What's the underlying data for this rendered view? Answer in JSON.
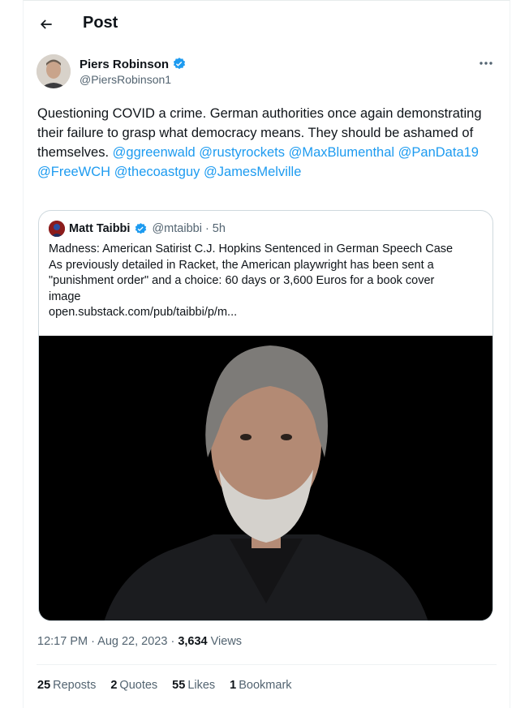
{
  "header": {
    "title": "Post"
  },
  "author": {
    "name": "Piers Robinson",
    "handle": "@PiersRobinson1",
    "verified": true
  },
  "tweet": {
    "text_plain": "Questioning COVID a crime. German authorities once again demonstrating their failure to grasp what democracy means. They should be ashamed of themselves.",
    "mentions": [
      "@ggreenwald",
      "@rustyrockets",
      "@MaxBlumenthal",
      "@PanData19",
      "@FreeWCH",
      "@thecoastguy",
      "@JamesMelville"
    ]
  },
  "quote": {
    "name": "Matt Taibbi",
    "verified": true,
    "handle_time": "@mtaibbi · 5h",
    "lines": [
      "Madness: American Satirist C.J. Hopkins Sentenced in German Speech Case",
      "As previously detailed in Racket, the American playwright has been sent a",
      "\"punishment order\" and a choice: 60 days or 3,600 Euros for a book cover",
      "image",
      "open.substack.com/pub/taibbi/p/m..."
    ]
  },
  "meta": {
    "time_date": "12:17 PM · Aug 22, 2023 · ",
    "views_count": "3,634",
    "views_label": " Views"
  },
  "stats": {
    "reposts_count": "25",
    "reposts_label": "Reposts",
    "quotes_count": "2",
    "quotes_label": "Quotes",
    "likes_count": "55",
    "likes_label": "Likes",
    "bookmarks_count": "1",
    "bookmarks_label": "Bookmark"
  },
  "colors": {
    "accent": "#1d9bf0",
    "text": "#0f1419",
    "muted": "#536471",
    "border": "#cfd9de"
  },
  "icons": [
    "back-arrow-icon",
    "verified-badge-icon",
    "more-icon"
  ]
}
